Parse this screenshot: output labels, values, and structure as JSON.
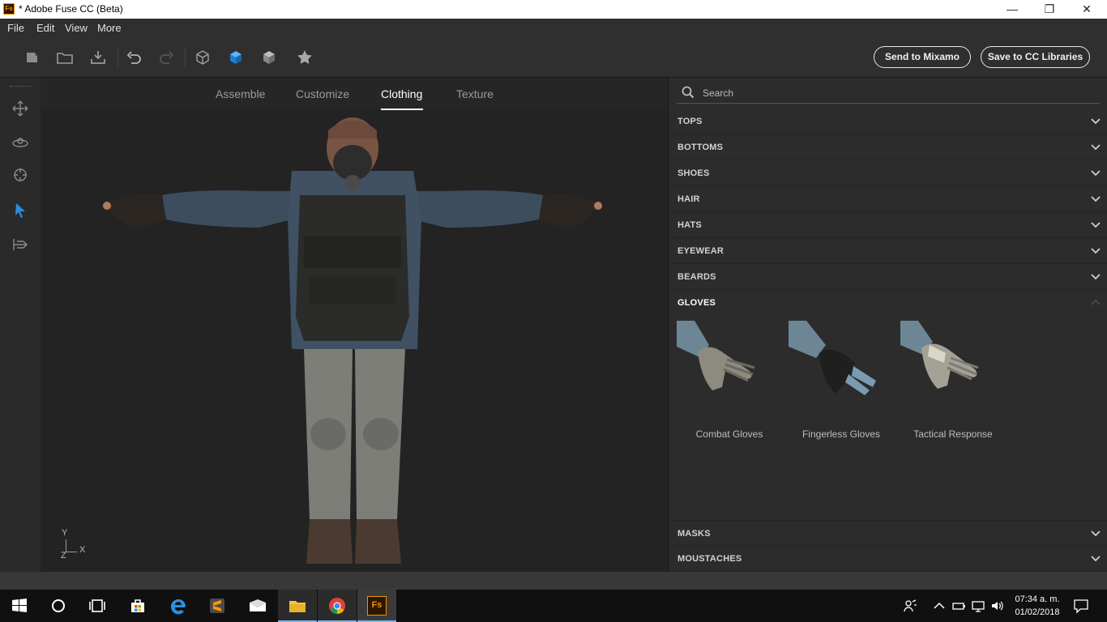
{
  "window": {
    "title": "* Adobe Fuse CC (Beta)",
    "app_icon_text": "Fs",
    "controls": [
      "—",
      "❐",
      "✕"
    ]
  },
  "menu": [
    "File",
    "Edit",
    "View",
    "More"
  ],
  "toolbar": {
    "send_label": "Send to Mixamo",
    "save_label": "Save to CC Libraries",
    "accent": "#2a8ee0"
  },
  "tabs": [
    "Assemble",
    "Customize",
    "Clothing",
    "Texture"
  ],
  "active_tab": "Clothing",
  "axis": {
    "y": "Y",
    "x": "X",
    "z": "Z"
  },
  "search": {
    "placeholder": "Search"
  },
  "categories": [
    "TOPS",
    "BOTTOMS",
    "SHOES",
    "HAIR",
    "HATS",
    "EYEWEAR",
    "BEARDS",
    "GLOVES"
  ],
  "open_category": "GLOVES",
  "gloves": [
    {
      "name": "Combat Gloves"
    },
    {
      "name": "Fingerless Gloves"
    },
    {
      "name": "Tactical Response"
    }
  ],
  "bottom_categories": [
    "MASKS",
    "MOUSTACHES"
  ],
  "taskbar": {
    "time": "07:34 a. m.",
    "date": "01/02/2018",
    "fuse_icon_text": "Fs"
  }
}
